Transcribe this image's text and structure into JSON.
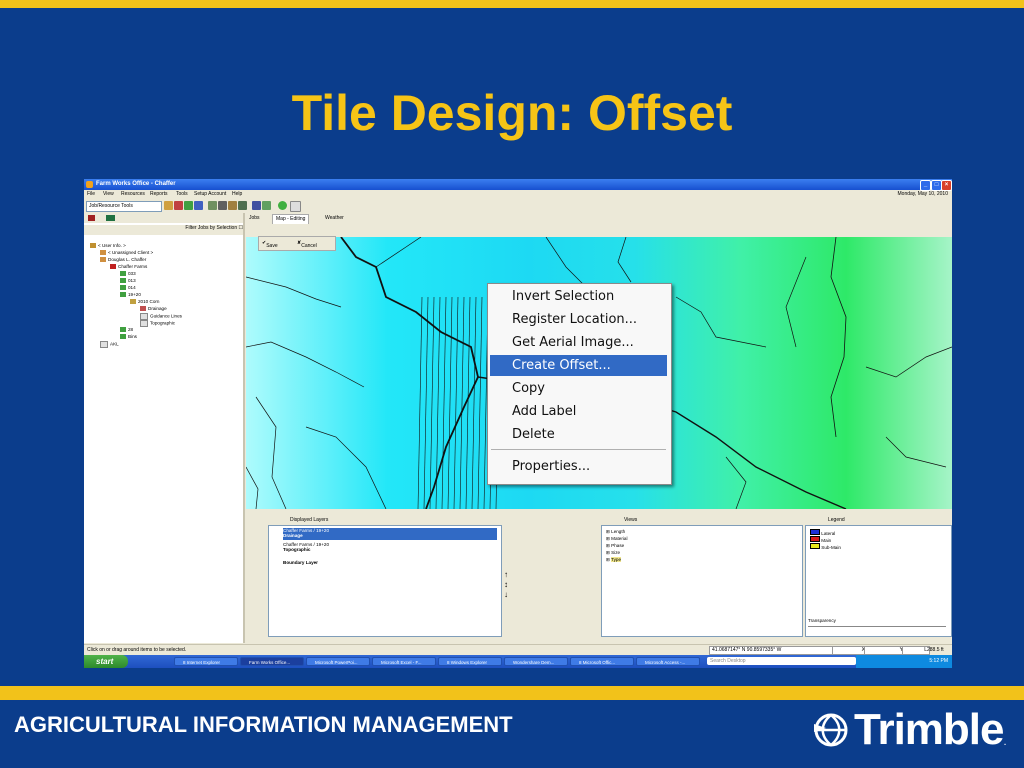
{
  "slide": {
    "title": "Tile Design:  Offset",
    "footer": "AGRICULTURAL INFORMATION MANAGEMENT",
    "logo_text": "Trimble",
    "logo_reg": ".",
    "colors": {
      "background": "#0b3d8c",
      "accent": "#f2c21a",
      "title": "#f6c416"
    }
  },
  "window": {
    "title": "Farm Works Office - Chaffer",
    "menu": [
      "File",
      "View",
      "Resources",
      "Reports",
      "Tools",
      "Setup Account",
      "Help"
    ],
    "date": "Monday, May 10, 2010",
    "toolbar_combo": "Job/Resource Tools",
    "filter_label": "Filter Jobs by Selection"
  },
  "tree": [
    {
      "label": "< User Info. >",
      "indent": 0
    },
    {
      "label": "< Unassigned Client >",
      "indent": 1
    },
    {
      "label": "Douglas L. Chaffer",
      "indent": 1
    },
    {
      "label": "Chaffer Farms",
      "indent": 2
    },
    {
      "label": "033",
      "indent": 3
    },
    {
      "label": "013",
      "indent": 3
    },
    {
      "label": "014",
      "indent": 3
    },
    {
      "label": "19+20",
      "indent": 3
    },
    {
      "label": "2010 Corn",
      "indent": 4
    },
    {
      "label": "Drainage",
      "indent": 5
    },
    {
      "label": "Guidance Lines",
      "indent": 5
    },
    {
      "label": "Topographic",
      "indent": 5
    },
    {
      "label": "28",
      "indent": 3
    },
    {
      "label": "Bins",
      "indent": 3
    },
    {
      "label": "AKL",
      "indent": 1
    }
  ],
  "tabs": [
    {
      "label": "Jobs",
      "active": false
    },
    {
      "label": "Map - Editing",
      "active": true
    },
    {
      "label": "Weather",
      "active": false
    }
  ],
  "edit_bar": {
    "save": "Save",
    "cancel": "Cancel"
  },
  "context_menu": {
    "items": [
      "Invert Selection",
      "Register Location...",
      "Get Aerial Image...",
      "Create Offset...",
      "Copy",
      "Add Label",
      "Delete",
      "Properties..."
    ],
    "selected": "Create Offset..."
  },
  "layers": {
    "header": "Displayed Layers",
    "items": [
      {
        "line1": "Chaffer Farms / 19+20",
        "line2": "Drainage",
        "selected": true
      },
      {
        "line1": "Chaffer Farms / 19+20",
        "line2": "Topographic",
        "selected": false
      },
      {
        "line1": "",
        "line2": "Boundary Layer",
        "selected": false
      }
    ]
  },
  "views": {
    "header": "Views",
    "items": [
      "Length",
      "Material",
      "Phase",
      "Size",
      "Type"
    ]
  },
  "legend": {
    "header": "Legend",
    "items": [
      {
        "label": "Lateral",
        "color": "#1c2fd8"
      },
      {
        "label": "Main",
        "color": "#d81c1c"
      },
      {
        "label": "Sub-Main",
        "color": "#e8e81c"
      }
    ],
    "transparency_label": "Transparency"
  },
  "status": {
    "message": "Click on or drag around items to be selected.",
    "coords": "41.0687147° N  90.8597335° W",
    "x_label": "X",
    "y_label": "Y",
    "l_label": "L",
    "distance": "288.5 ft"
  },
  "taskbar": {
    "start": "start",
    "tasks": [
      "8 Internet Explorer",
      "Farm Works Office...",
      "Microsoft PowerPoi...",
      "Microsoft Excel - F...",
      "8 Windows Explorer",
      "Wondershare Dem...",
      "8 Microsoft Offic...",
      "Microsoft Access -..."
    ],
    "search_placeholder": "Search Desktop",
    "clock": "5:12 PM"
  }
}
